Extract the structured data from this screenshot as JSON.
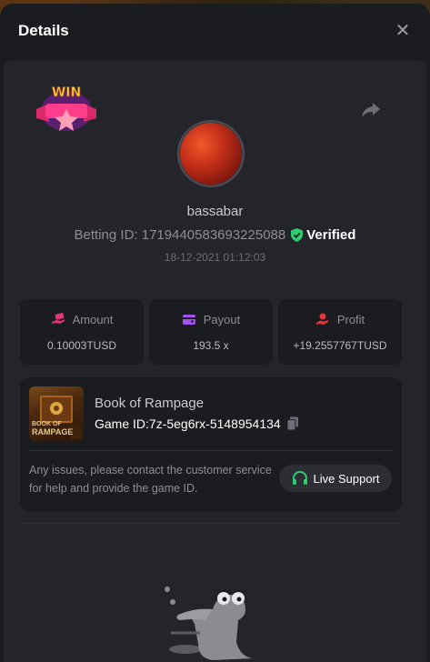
{
  "modal": {
    "title": "Details"
  },
  "player": {
    "username": "bassabar",
    "betting_id": "Betting ID: 1719440583693225088",
    "verified_label": "Verified",
    "timestamp": "18-12-2021 01:12:03"
  },
  "stats": [
    {
      "label": "Amount",
      "value": "0.10003TUSD",
      "icon": "money-hand-icon",
      "color": "#e8357a"
    },
    {
      "label": "Payout",
      "value": "193.5 x",
      "icon": "wallet-icon",
      "color": "#a74ff0"
    },
    {
      "label": "Profit",
      "value": "+19.2557767TUSD",
      "icon": "coin-hand-icon",
      "color": "#e8353a"
    }
  ],
  "game": {
    "name": "Book of Rampage",
    "game_id": "Game ID:7z-5eg6rx-5148954134",
    "thumb_text_1": "BOOK OF",
    "thumb_text_2": "RAMPAGE"
  },
  "support": {
    "help_text": "Any issues, please contact the customer service for help and provide the game ID.",
    "button_label": "Live Support"
  },
  "badge": {
    "text": "WIN"
  },
  "colors": {
    "verified": "#2ecc71",
    "support_icon": "#2ecc71",
    "accent_pink": "#e8357a"
  }
}
